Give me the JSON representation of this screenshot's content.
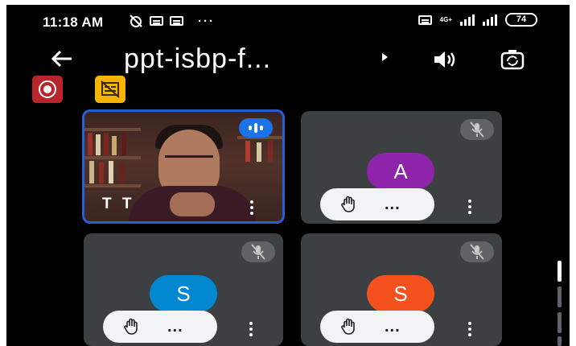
{
  "status_bar": {
    "time": "11:18 AM",
    "more_indicator": "···",
    "network_type": "4G+",
    "battery": "74"
  },
  "call": {
    "title": "ppt-isbp-f...",
    "accent_color": "#1a73e8"
  },
  "participants": [
    {
      "label": "T T",
      "state": "speaking",
      "video_on": true
    },
    {
      "initial": "A",
      "avatar_color": "#8e24aa",
      "muted": true
    },
    {
      "initial": "S",
      "avatar_color": "#0288d1",
      "muted": true
    },
    {
      "initial": "S",
      "avatar_color": "#f4511e",
      "muted": true
    }
  ],
  "tile_actions": {
    "raise_hand_icon": "hand-icon",
    "more_label": "..."
  },
  "icons": [
    "back-arrow-icon",
    "dropdown-caret-icon",
    "speaker-icon",
    "switch-camera-icon",
    "record-icon",
    "captions-off-icon",
    "mic-off-icon",
    "more-vert-icon"
  ]
}
